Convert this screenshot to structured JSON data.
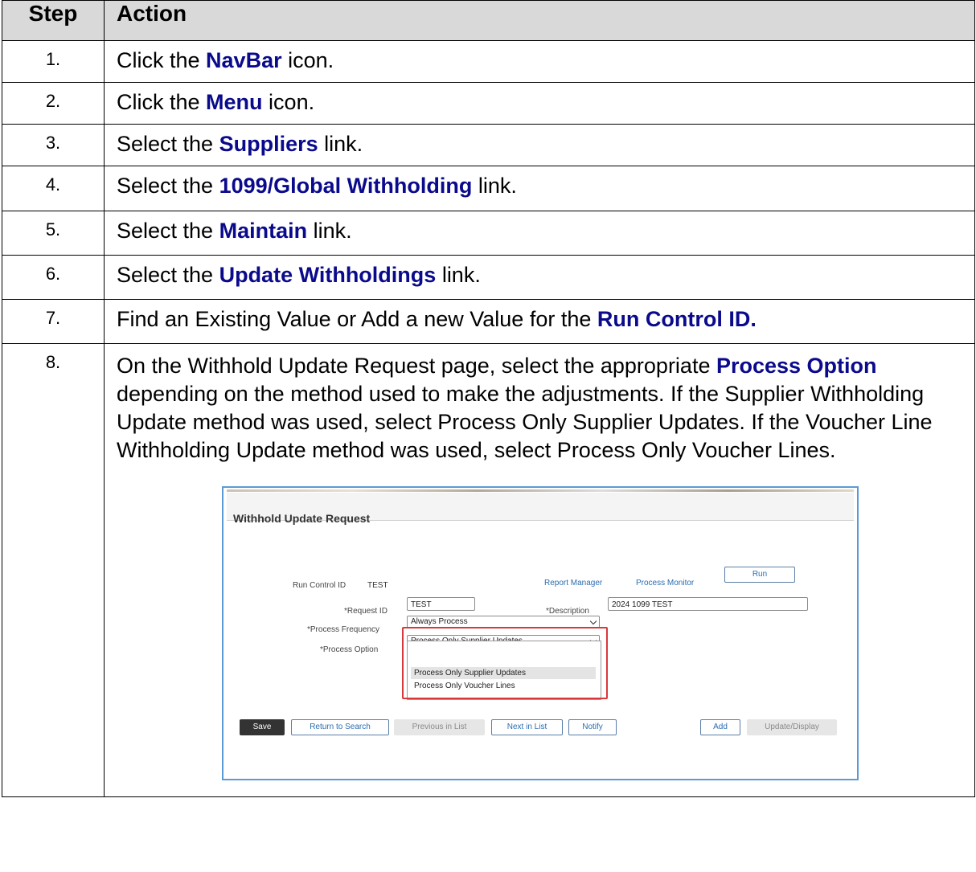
{
  "header": {
    "step": "Step",
    "action": "Action"
  },
  "rows": [
    {
      "num": "1.",
      "pre": "Click the ",
      "kw": "NavBar",
      "post": " icon."
    },
    {
      "num": "2.",
      "pre": "Click the ",
      "kw": "Menu",
      "post": " icon."
    },
    {
      "num": "3.",
      "pre": "Select the ",
      "kw": "Suppliers",
      "post": " link."
    },
    {
      "num": "4.",
      "pre": "Select the ",
      "kw": "1099/Global Withholding",
      "post": " link."
    },
    {
      "num": "5.",
      "pre": "Select the ",
      "kw": "Maintain",
      "post": " link."
    },
    {
      "num": "6.",
      "pre": "Select the ",
      "kw": "Update Withholdings",
      "post": " link."
    },
    {
      "num": "7.",
      "pre": "Find an Existing Value or Add a new Value for the ",
      "kw": "Run Control ID.",
      "post": ""
    }
  ],
  "row8": {
    "num": "8.",
    "pre": "On the Withhold Update Request page, select the appropriate ",
    "kw": "Process Option",
    "post": " depending on the method used to make the adjustments. If the Supplier Withholding Update method was used, select Process Only Supplier Updates. If the Voucher Line Withholding Update method was used, select Process Only Voucher Lines."
  },
  "screenshot": {
    "title": "Withhold Update Request",
    "run_control_label": "Run Control ID",
    "run_control_value": "TEST",
    "report_manager": "Report Manager",
    "process_monitor": "Process Monitor",
    "run_button": "Run",
    "request_id_label": "*Request ID",
    "request_id_value": "TEST",
    "description_label": "*Description",
    "description_value": "2024 1099 TEST",
    "frequency_label": "*Process Frequency",
    "frequency_value": "Always Process",
    "option_label": "*Process Option",
    "option_value": "Process Only Supplier Updates",
    "options": [
      "Process Only Supplier Updates",
      "Process Only Voucher Lines"
    ],
    "buttons": {
      "save": "Save",
      "return_to_search": "Return to Search",
      "previous_in_list": "Previous in List",
      "next_in_list": "Next in List",
      "notify": "Notify",
      "add": "Add",
      "update_display": "Update/Display"
    }
  }
}
